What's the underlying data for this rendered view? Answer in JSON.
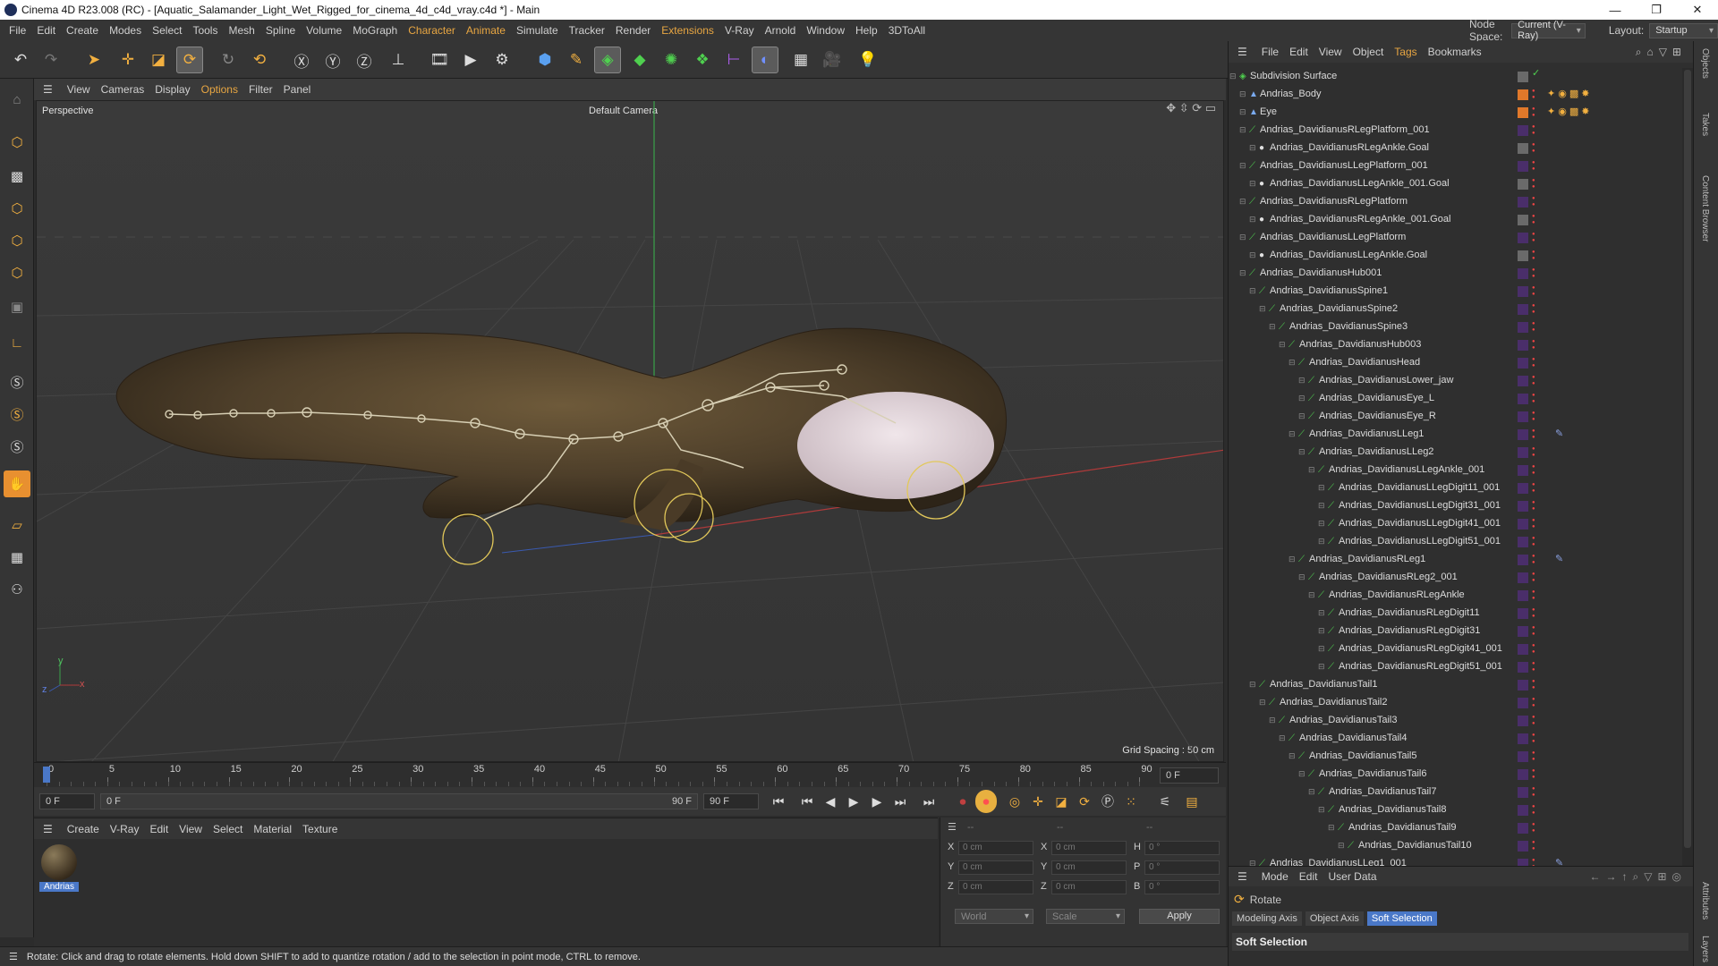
{
  "window": {
    "title": "Cinema 4D R23.008 (RC) - [Aquatic_Salamander_Light_Wet_Rigged_for_cinema_4d_c4d_vray.c4d *] - Main",
    "minimize": "—",
    "restore": "❐",
    "close": "✕"
  },
  "menubar": [
    "File",
    "Edit",
    "Create",
    "Modes",
    "Select",
    "Tools",
    "Mesh",
    "Spline",
    "Volume",
    "MoGraph",
    "Character",
    "Animate",
    "Simulate",
    "Tracker",
    "Render",
    "Extensions",
    "V-Ray",
    "Arnold",
    "Window",
    "Help",
    "3DToAll"
  ],
  "nodespace": {
    "label": "Node Space:",
    "value": "Current (V-Ray)",
    "layout_label": "Layout:",
    "layout_value": "Startup"
  },
  "viewport": {
    "menu": [
      "View",
      "Cameras",
      "Display",
      "Options",
      "Filter",
      "Panel"
    ],
    "name": "Perspective",
    "camera": "Default Camera",
    "grid_spacing": "Grid Spacing : 50 cm",
    "axis_x": "x",
    "axis_y": "y",
    "axis_z": "z"
  },
  "timeline": {
    "ticks": [
      "0",
      "5",
      "10",
      "15",
      "20",
      "25",
      "30",
      "35",
      "40",
      "45",
      "50",
      "55",
      "60",
      "65",
      "70",
      "75",
      "80",
      "85",
      "90"
    ],
    "current_frame": "0 F",
    "start": "0 F",
    "range_start": "0 F",
    "range_end": "90 F",
    "end": "90 F"
  },
  "material_menu": [
    "Create",
    "V-Ray",
    "Edit",
    "View",
    "Select",
    "Material",
    "Texture"
  ],
  "material": {
    "name": "Andrias"
  },
  "coords": {
    "header1": "--",
    "header2": "--",
    "header3": "--",
    "rows": [
      {
        "a": "X",
        "av": "0 cm",
        "b": "X",
        "bv": "0 cm",
        "c": "H",
        "cv": "0 °"
      },
      {
        "a": "Y",
        "av": "0 cm",
        "b": "Y",
        "bv": "0 cm",
        "c": "P",
        "cv": "0 °"
      },
      {
        "a": "Z",
        "av": "0 cm",
        "b": "Z",
        "bv": "0 cm",
        "c": "B",
        "cv": "0 °"
      }
    ],
    "space": "World",
    "mode": "Scale",
    "apply": "Apply"
  },
  "status": "Rotate: Click and drag to rotate elements. Hold down SHIFT to add to quantize rotation / add to the selection in point mode, CTRL to remove.",
  "object_menu": [
    "File",
    "Edit",
    "View",
    "Object",
    "Tags",
    "Bookmarks"
  ],
  "objects": [
    {
      "name": "Subdivision Surface",
      "indent": 0,
      "type": "sub"
    },
    {
      "name": "Andrias_Body",
      "indent": 1,
      "type": "poly"
    },
    {
      "name": "Eye",
      "indent": 1,
      "type": "poly"
    },
    {
      "name": "Andrias_DavidianusRLegPlatform_001",
      "indent": 1,
      "type": "bone"
    },
    {
      "name": "Andrias_DavidianusRLegAnkle.Goal",
      "indent": 2,
      "type": "goal"
    },
    {
      "name": "Andrias_DavidianusLLegPlatform_001",
      "indent": 1,
      "type": "bone"
    },
    {
      "name": "Andrias_DavidianusLLegAnkle_001.Goal",
      "indent": 2,
      "type": "goal"
    },
    {
      "name": "Andrias_DavidianusRLegPlatform",
      "indent": 1,
      "type": "bone"
    },
    {
      "name": "Andrias_DavidianusRLegAnkle_001.Goal",
      "indent": 2,
      "type": "goal"
    },
    {
      "name": "Andrias_DavidianusLLegPlatform",
      "indent": 1,
      "type": "bone"
    },
    {
      "name": "Andrias_DavidianusLLegAnkle.Goal",
      "indent": 2,
      "type": "goal"
    },
    {
      "name": "Andrias_DavidianusHub001",
      "indent": 1,
      "type": "bone"
    },
    {
      "name": "Andrias_DavidianusSpine1",
      "indent": 2,
      "type": "bone"
    },
    {
      "name": "Andrias_DavidianusSpine2",
      "indent": 3,
      "type": "bone"
    },
    {
      "name": "Andrias_DavidianusSpine3",
      "indent": 4,
      "type": "bone"
    },
    {
      "name": "Andrias_DavidianusHub003",
      "indent": 5,
      "type": "bone"
    },
    {
      "name": "Andrias_DavidianusHead",
      "indent": 6,
      "type": "bone"
    },
    {
      "name": "Andrias_DavidianusLower_jaw",
      "indent": 7,
      "type": "bone"
    },
    {
      "name": "Andrias_DavidianusEye_L",
      "indent": 7,
      "type": "bone"
    },
    {
      "name": "Andrias_DavidianusEye_R",
      "indent": 7,
      "type": "bone"
    },
    {
      "name": "Andrias_DavidianusLLeg1",
      "indent": 6,
      "type": "bone",
      "tag": true
    },
    {
      "name": "Andrias_DavidianusLLeg2",
      "indent": 7,
      "type": "bone"
    },
    {
      "name": "Andrias_DavidianusLLegAnkle_001",
      "indent": 8,
      "type": "bone"
    },
    {
      "name": "Andrias_DavidianusLLegDigit11_001",
      "indent": 9,
      "type": "bone"
    },
    {
      "name": "Andrias_DavidianusLLegDigit31_001",
      "indent": 9,
      "type": "bone"
    },
    {
      "name": "Andrias_DavidianusLLegDigit41_001",
      "indent": 9,
      "type": "bone"
    },
    {
      "name": "Andrias_DavidianusLLegDigit51_001",
      "indent": 9,
      "type": "bone"
    },
    {
      "name": "Andrias_DavidianusRLeg1",
      "indent": 6,
      "type": "bone",
      "tag": true
    },
    {
      "name": "Andrias_DavidianusRLeg2_001",
      "indent": 7,
      "type": "bone"
    },
    {
      "name": "Andrias_DavidianusRLegAnkle",
      "indent": 8,
      "type": "bone"
    },
    {
      "name": "Andrias_DavidianusRLegDigit11",
      "indent": 9,
      "type": "bone"
    },
    {
      "name": "Andrias_DavidianusRLegDigit31",
      "indent": 9,
      "type": "bone"
    },
    {
      "name": "Andrias_DavidianusRLegDigit41_001",
      "indent": 9,
      "type": "bone"
    },
    {
      "name": "Andrias_DavidianusRLegDigit51_001",
      "indent": 9,
      "type": "bone"
    },
    {
      "name": "Andrias_DavidianusTail1",
      "indent": 2,
      "type": "bone"
    },
    {
      "name": "Andrias_DavidianusTail2",
      "indent": 3,
      "type": "bone"
    },
    {
      "name": "Andrias_DavidianusTail3",
      "indent": 4,
      "type": "bone"
    },
    {
      "name": "Andrias_DavidianusTail4",
      "indent": 5,
      "type": "bone"
    },
    {
      "name": "Andrias_DavidianusTail5",
      "indent": 6,
      "type": "bone"
    },
    {
      "name": "Andrias_DavidianusTail6",
      "indent": 7,
      "type": "bone"
    },
    {
      "name": "Andrias_DavidianusTail7",
      "indent": 8,
      "type": "bone"
    },
    {
      "name": "Andrias_DavidianusTail8",
      "indent": 9,
      "type": "bone"
    },
    {
      "name": "Andrias_DavidianusTail9",
      "indent": 10,
      "type": "bone"
    },
    {
      "name": "Andrias_DavidianusTail10",
      "indent": 11,
      "type": "bone"
    },
    {
      "name": "Andrias_DavidianusLLeg1_001",
      "indent": 2,
      "type": "bone",
      "tag": true
    }
  ],
  "attributes": {
    "menu": [
      "Mode",
      "Edit",
      "User Data"
    ],
    "tool": "Rotate",
    "tabs": [
      "Modeling Axis",
      "Object Axis",
      "Soft Selection"
    ],
    "section": "Soft Selection"
  },
  "side_tabs": [
    "Objects",
    "Takes",
    "Content Browser",
    "Attributes",
    "Layers"
  ],
  "colors": {
    "accent": "#5a8dd6",
    "highlight_menu": "#e8a642",
    "bone": "#4fd04f",
    "camera_green": "#3aa24a",
    "selected_tab": "#4a78c8"
  }
}
